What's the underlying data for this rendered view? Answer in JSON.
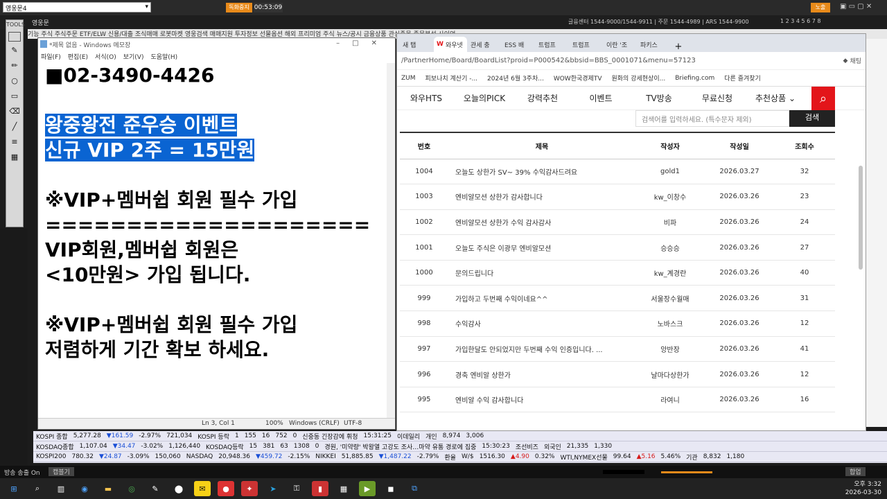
{
  "host": {
    "dropdown": "영웅문4",
    "timer_label": "독화중지",
    "timer_value": "00:53:09",
    "app_title": "영웅문",
    "contact_line": "글융센터 1544-9000/1544-9911 | 주문 1544-4989 | ARS 1544-9900",
    "page_nums": "1 2 3 4 5 6 7 8",
    "btn_right": "노출",
    "menu": "기능  주식  주식주문  ETF/ELW  신용/대출  조식매매  로봇마켓  영웅검색  매매지원  투자정보  선물옵션  해외  프리미엄  주식  뉴스/공시  금융상품  관심종목  종목분석  사이언  ..."
  },
  "notepad": {
    "title": "*제목 없음 - Windows 메모장",
    "menu": [
      "파일(F)",
      "편집(E)",
      "서식(O)",
      "보기(V)",
      "도움말(H)"
    ],
    "lines": {
      "l1": "■02-3490-4426",
      "l2": "왕중왕전 준우승 이벤트",
      "l3": "신규 VIP 2주 = 15만원",
      "l4": "※VIP+멤버쉽 회원 필수 가입",
      "l5": "====================",
      "l6": "VIP회원,멤버쉽 회원은",
      "l7": "<10만원> 가입 됩니다.",
      "l8": "※VIP+멤버쉽 회원 필수 가입",
      "l9": "저렴하게 기간 확보 하세요."
    },
    "status": {
      "position": "Ln 3, Col 1",
      "zoom": "100%",
      "eol": "Windows (CRLF)",
      "encoding": "UTF-8"
    }
  },
  "browser": {
    "tabs": [
      "새 탭",
      "와우넷",
      "관세 충",
      "ESS 배",
      "트럼프",
      "트럼프",
      "이란 '조",
      "파키스"
    ],
    "address": "/PartnerHome/Board/BoardList?proid=P000542&bbsid=BBS_0001071&menu=57123",
    "favorites": [
      "ZUM",
      "피보나치 계산기 -...",
      "2024년 6월 3주차...",
      "WOW한국경제TV",
      "원화의 강세현상이...",
      "Briefing.com",
      "다른 즐겨찾기"
    ],
    "copilot_label": "채팅",
    "nav": [
      "와우HTS",
      "오늘의PICK",
      "강력추천",
      "이벤트",
      "TV방송",
      "무료신청",
      "추천상품"
    ],
    "search_placeholder": "검색어를 입력하세요. (특수문자 제외)",
    "search_button": "검색",
    "columns": [
      "번호",
      "제목",
      "작성자",
      "작성일",
      "조회수"
    ],
    "rows": [
      {
        "no": "1004",
        "title": "오늘도 상한가 SV~ 39% 수익감사드려요",
        "author": "gold1",
        "date": "2026.03.27",
        "views": "32"
      },
      {
        "no": "1003",
        "title": "엔비알모션 상한가 감사합니다",
        "author": "kw_이창수",
        "date": "2026.03.26",
        "views": "23"
      },
      {
        "no": "1002",
        "title": "엔비알모션 상한가 수익 감사감사",
        "author": "비파",
        "date": "2026.03.26",
        "views": "24"
      },
      {
        "no": "1001",
        "title": "오늘도 주식은 이광무 엔비알모션",
        "author": "승승승",
        "date": "2026.03.26",
        "views": "27"
      },
      {
        "no": "1000",
        "title": "문의드립니다",
        "author": "kw_계경란",
        "date": "2026.03.26",
        "views": "40"
      },
      {
        "no": "999",
        "title": "가입하고 두번째 수익이네요^^",
        "author": "서울장수월매",
        "date": "2026.03.26",
        "views": "31"
      },
      {
        "no": "998",
        "title": "수익감사",
        "author": "노바스크",
        "date": "2026.03.26",
        "views": "12"
      },
      {
        "no": "997",
        "title": "가입한달도 안되었지만 두번째 수익 인증입니다. ...",
        "author": "앙반장",
        "date": "2026.03.26",
        "views": "41"
      },
      {
        "no": "996",
        "title": "경축 엔비알 상한가",
        "author": "날마다상한가",
        "date": "2026.03.26",
        "views": "12"
      },
      {
        "no": "995",
        "title": "엔비알 수익 감사합니다",
        "author": "라여니",
        "date": "2026.03.26",
        "views": "16"
      }
    ]
  },
  "ticker": {
    "row1": [
      "KOSPI 종합",
      "5,277.28",
      "▼161.59",
      "-2.97%",
      "721,034",
      "KOSPI 등락",
      "1",
      "155",
      "16",
      "752",
      "0",
      "신중동 긴장감에 휘청",
      "15:31:25",
      "이데일리",
      "개인",
      "8,974",
      "3,006"
    ],
    "row2": [
      "KOSDAQ종합",
      "1,107.04",
      "▼34.47",
      "-3.02%",
      "1,126,440",
      "KOSDAQ등락",
      "15",
      "381",
      "63",
      "1308",
      "0",
      "경원, '미약량' 박왕열 고강도 조사…마약 유통 경로에 집중",
      "15:30:23",
      "조선비즈",
      "외국인",
      "21,335",
      "1,330"
    ],
    "row3": [
      "KOSPI200",
      "780.32",
      "▼24.87",
      "-3.09%",
      "150,060",
      "NASDAQ",
      "20,948.36",
      "▼459.72",
      "-2.15%",
      "NIKKEI",
      "51,885.85",
      "▼1,487.22",
      "-2.79%",
      "환율",
      "W/$",
      "1516.30",
      "▲4.90",
      "0.32%",
      "WTI,NYMEX선물",
      "99.64",
      "▲5.16",
      "5.46%",
      "기관",
      "8,832",
      "1,180"
    ]
  },
  "status_strip": {
    "left": "방송 송출 On",
    "btn": "캡블기",
    "right": "합업"
  },
  "taskbar": {
    "time": "오후 3:32",
    "date": "2026-03-30"
  }
}
